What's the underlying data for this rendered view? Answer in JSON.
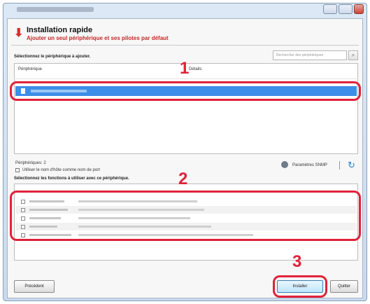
{
  "header": {
    "title": "Installation rapide",
    "subtitle": "Ajouter un seul périphérique et ses pilotes par défaut"
  },
  "device_section": {
    "label": "Sélectionnez le périphérique à ajouter.",
    "search_placeholder": "Rechercher des périphériques",
    "columns": [
      "Périphérique",
      "Détails"
    ],
    "count_text": "Périphériques: 2"
  },
  "options": {
    "use_hostname_label": "Utiliser le nom d'hôte comme nom de port",
    "snmp_label": "Paramètres SNMP"
  },
  "functions_section": {
    "label": "Sélectionnez les fonctions à utiliser avec ce périphérique."
  },
  "annotations": [
    "1",
    "2",
    "3"
  ],
  "buttons": {
    "back": "Précédent",
    "install": "Installer",
    "quit": "Quitter"
  },
  "colors": {
    "accent_red": "#e0223a",
    "selection_blue": "#3d8ee8"
  },
  "icons": {
    "header": "down-arrow-icon",
    "search": "search-icon",
    "snmp": "snmp-settings-icon",
    "refresh": "refresh-icon"
  }
}
